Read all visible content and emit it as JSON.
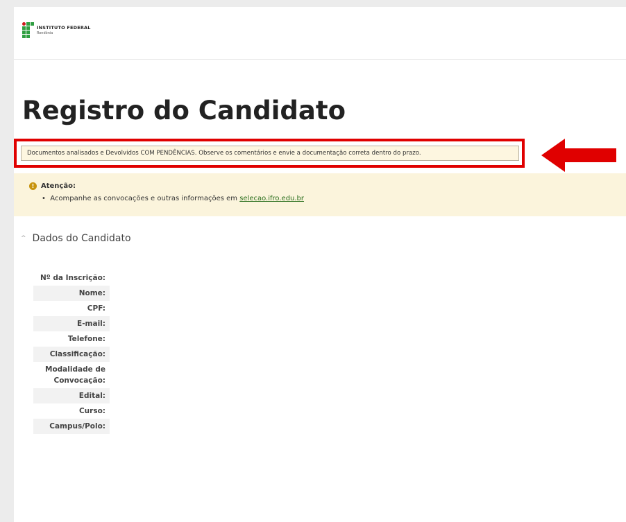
{
  "logo": {
    "main": "INSTITUTO FEDERAL",
    "sub": "Rondônia"
  },
  "page": {
    "title": "Registro do Candidato"
  },
  "status": {
    "text": "Documentos analisados e Devolvidos COM PENDÊNCIAS. Observe os comentários e envie a documentação correta dentro do prazo."
  },
  "attention": {
    "title": "Atenção:",
    "item_prefix": "Acompanhe as convocações e outras informações em ",
    "link": "selecao.ifro.edu.br"
  },
  "section": {
    "title": "Dados do Candidato"
  },
  "fields": [
    "Nº da Inscrição:",
    "Nome:",
    "CPF:",
    "E-mail:",
    "Telefone:",
    "Classificação:",
    "Modalidade de Convocação:",
    "Edital:",
    "Curso:",
    "Campus/Polo:"
  ],
  "colors": {
    "highlight": "#e00000",
    "logo_green": "#2f9e41",
    "notice_bg": "#fbf4dc"
  }
}
